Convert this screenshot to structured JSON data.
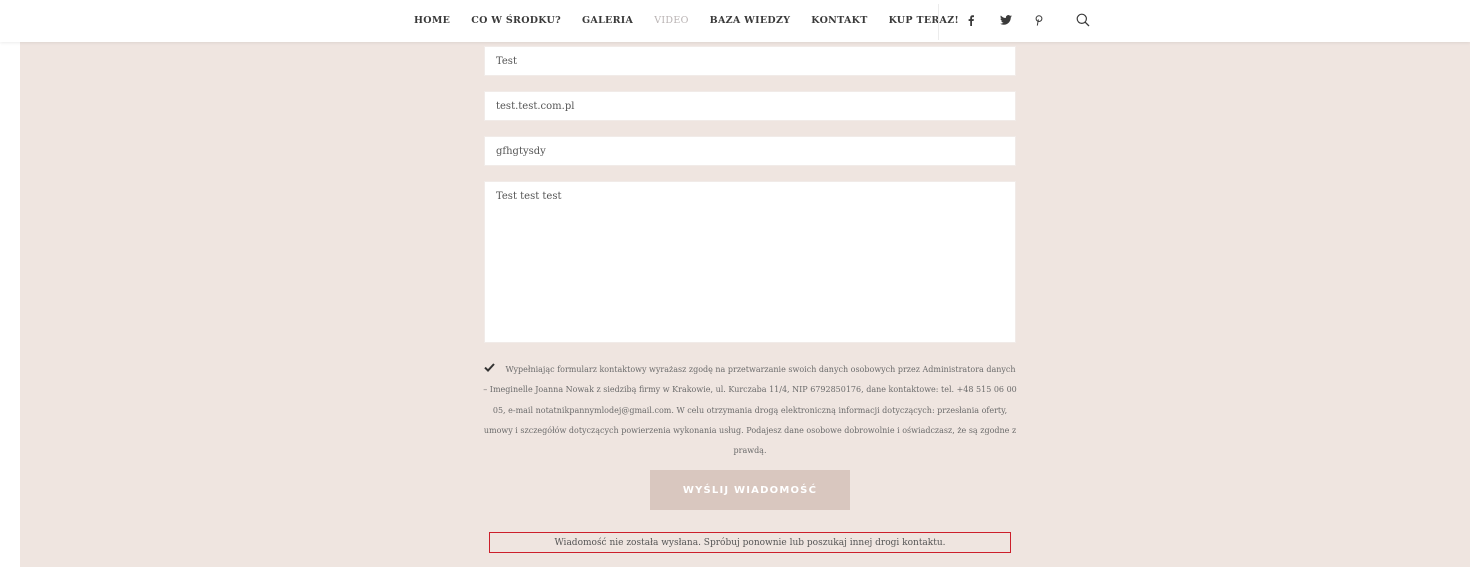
{
  "nav": {
    "items": [
      {
        "label": "HOME"
      },
      {
        "label": "CO W ŚRODKU?"
      },
      {
        "label": "GALERIA"
      },
      {
        "label": "VIDEO"
      },
      {
        "label": "BAZA WIEDZY"
      },
      {
        "label": "KONTAKT"
      },
      {
        "label": "KUP TERAZ!"
      }
    ],
    "active_item": "VIDEO",
    "social_icons": [
      "facebook-icon",
      "twitter-icon",
      "pinterest-icon"
    ],
    "search_icon": "search-icon"
  },
  "form": {
    "name_value": "Test",
    "email_value": "test.test.com.pl",
    "subject_value": "gfhgtysdy",
    "message_value": "Test test test",
    "consent_checked": true,
    "consent_text": "Wypełniając formularz kontaktowy wyrażasz zgodę na przetwarzanie swoich danych osobowych przez Administratora danych – Imeginelle Joanna Nowak z siedzibą firmy w Krakowie, ul. Kurczaba 11/4, NIP 6792850176, dane kontaktowe: tel. +48 515 06 00 05, e-mail notatnikpannymlodej@gmail.com. W celu otrzymania drogą elektroniczną informacji dotyczących: przesłania oferty, umowy i szczegółów dotyczących powierzenia wykonania usług. Podajesz dane osobowe dobrowolnie i oświadczasz, że są zgodne z prawdą.",
    "submit_label": "WYŚLIJ WIADOMOŚĆ",
    "error_message": "Wiadomość nie została wysłana. Spróbuj ponownie lub poszukaj innej drogi kontaktu."
  },
  "colors": {
    "page_background": "#efe5e0",
    "button_background": "#d9c7bf",
    "error_border": "#cc1f2b",
    "nav_active": "#b9b3b3"
  }
}
